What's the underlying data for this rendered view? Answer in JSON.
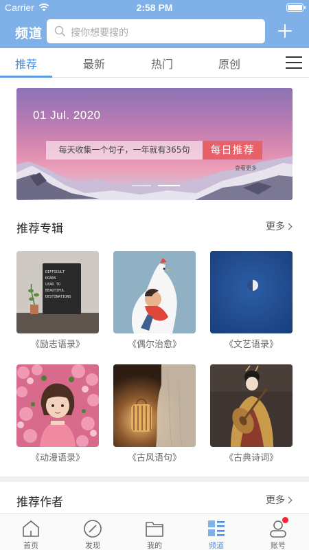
{
  "status_bar": {
    "carrier": "Carrier",
    "time": "2:58 PM"
  },
  "header": {
    "title": "频道",
    "search_placeholder": "搜你想要搜的"
  },
  "tabs": [
    {
      "label": "推荐",
      "active": true
    },
    {
      "label": "最新",
      "active": false
    },
    {
      "label": "热门",
      "active": false
    },
    {
      "label": "原创",
      "active": false
    }
  ],
  "banner": {
    "date": "01 Jul. 2020",
    "quote": "每天收集一个句子，一年就有365句",
    "button": "每日推荐",
    "see_more": "查看更多"
  },
  "albums_section": {
    "title": "推荐专辑",
    "more": "更多",
    "items": [
      {
        "label": "《励志语录》",
        "image": "letterboard-plant-photo"
      },
      {
        "label": "《偶尔治愈》",
        "image": "boy-hugging-chicken-illustration"
      },
      {
        "label": "《文艺语录》",
        "image": "half-moon-blue-sky-photo"
      },
      {
        "label": "《动漫语录》",
        "image": "anime-girl-pink-flowers"
      },
      {
        "label": "《古风语句》",
        "image": "lantern-hanfu-photo"
      },
      {
        "label": "《古典诗词》",
        "image": "pipa-player-traditional-photo"
      }
    ]
  },
  "letterboard_text": "DIFFICULT ROADS LEAD TO BEAUTIFUL DESTINATIONS",
  "authors_section": {
    "title": "推荐作者",
    "more": "更多"
  },
  "tabbar": [
    {
      "label": "首页",
      "icon": "home-icon",
      "active": false
    },
    {
      "label": "发现",
      "icon": "compass-icon",
      "active": false
    },
    {
      "label": "我的",
      "icon": "folder-icon",
      "active": false
    },
    {
      "label": "频道",
      "icon": "channel-icon",
      "active": true
    },
    {
      "label": "账号",
      "icon": "account-icon",
      "active": false,
      "badge": true
    }
  ],
  "colors": {
    "header_blue": "#7fb0e8",
    "accent_blue": "#4a8ee0",
    "banner_button": "#e86068",
    "badge_red": "#ff2233"
  }
}
